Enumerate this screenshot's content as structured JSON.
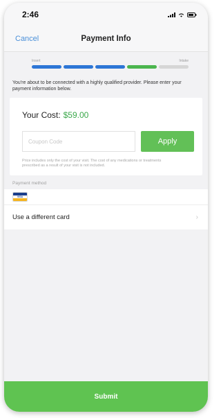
{
  "status_bar": {
    "time": "2:46"
  },
  "nav": {
    "cancel_label": "Cancel",
    "title": "Payment Info"
  },
  "progress": {
    "start_label": "Insert",
    "end_label": "Intake",
    "segments": [
      {
        "color": "#2d76d6"
      },
      {
        "color": "#2d76d6"
      },
      {
        "color": "#2d76d6"
      },
      {
        "color": "#4bb54e"
      },
      {
        "color": "#d6d6d6"
      }
    ]
  },
  "intro_text": "You're about to be connected with a highly qualified provider. Please enter your payment information below.",
  "cost": {
    "label": "Your Cost:",
    "amount": "$59.00"
  },
  "coupon": {
    "placeholder": "Coupon Code",
    "apply_label": "Apply"
  },
  "disclaimer": "Price includes only the cost of your visit. The cost of any medications or treatments prescribed as a result of your visit is not included.",
  "payment": {
    "section_header": "Payment method",
    "card_brand": "VISA",
    "different_card_label": "Use a different card"
  },
  "submit_label": "Submit",
  "colors": {
    "accent_green": "#5fc351",
    "price_green": "#3aa84a",
    "link_blue": "#4a90d9"
  }
}
